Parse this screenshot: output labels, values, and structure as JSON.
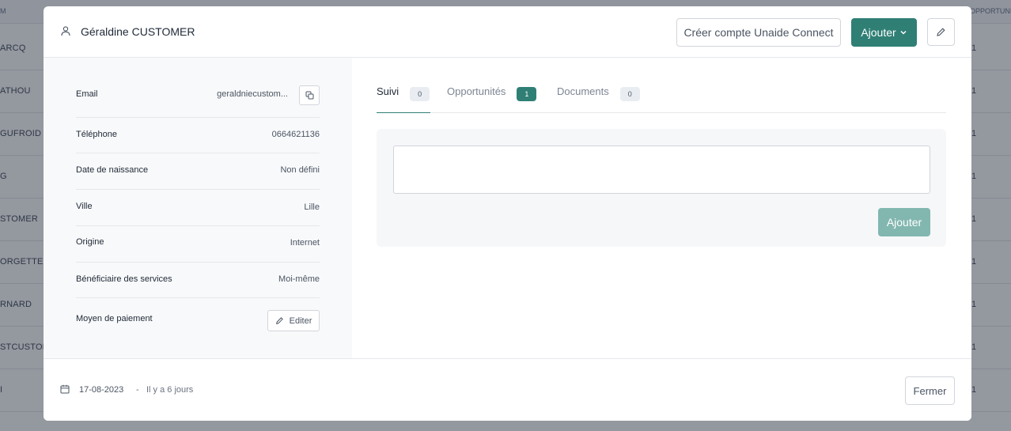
{
  "background_table": {
    "header_left": "M",
    "header_right": "OPPORTUNI",
    "rows": [
      {
        "name": "ARCQ",
        "count": "1"
      },
      {
        "name": "ATHOU",
        "count": "1"
      },
      {
        "name": "GUFROID",
        "count": "1"
      },
      {
        "name": "G",
        "count": "1"
      },
      {
        "name": "STOMER",
        "count": "1"
      },
      {
        "name": "ORGETTE",
        "count": "1"
      },
      {
        "name": "RNARD",
        "count": "1"
      },
      {
        "name": "STCUSTOM",
        "count": "1"
      },
      {
        "name": "I",
        "count": "1"
      }
    ]
  },
  "modal": {
    "header": {
      "user_icon": "user-icon",
      "name": "Géraldine CUSTOMER",
      "connect_button": "Créer compte Unaide Connect",
      "add_button": "Ajouter",
      "edit_icon": "pencil-icon"
    },
    "info": [
      {
        "label": "Email",
        "value": "geraldniecustom..."
      },
      {
        "label": "Téléphone",
        "value": "0664621136"
      },
      {
        "label": "Date de naissance",
        "value": "Non défini"
      },
      {
        "label": "Ville",
        "value": "Lille"
      },
      {
        "label": "Origine",
        "value": "Internet"
      },
      {
        "label": "Bénéficiaire des services",
        "value": "Moi-même"
      },
      {
        "label": "Moyen de paiement",
        "value": ""
      }
    ],
    "payment_edit_button": "Editer",
    "tabs": [
      {
        "label": "Suivi",
        "count": "0",
        "active": true
      },
      {
        "label": "Opportunités",
        "count": "1",
        "active": false
      },
      {
        "label": "Documents",
        "count": "0",
        "active": false
      }
    ],
    "suivi": {
      "textarea_value": "",
      "add_button": "Ajouter"
    },
    "footer": {
      "date": "17-08-2023",
      "separator": "-",
      "relative": "Il y a 6 jours",
      "close_button": "Fermer"
    }
  },
  "colors": {
    "primary": "#2f7f75",
    "primary_disabled": "#82b7b0"
  }
}
